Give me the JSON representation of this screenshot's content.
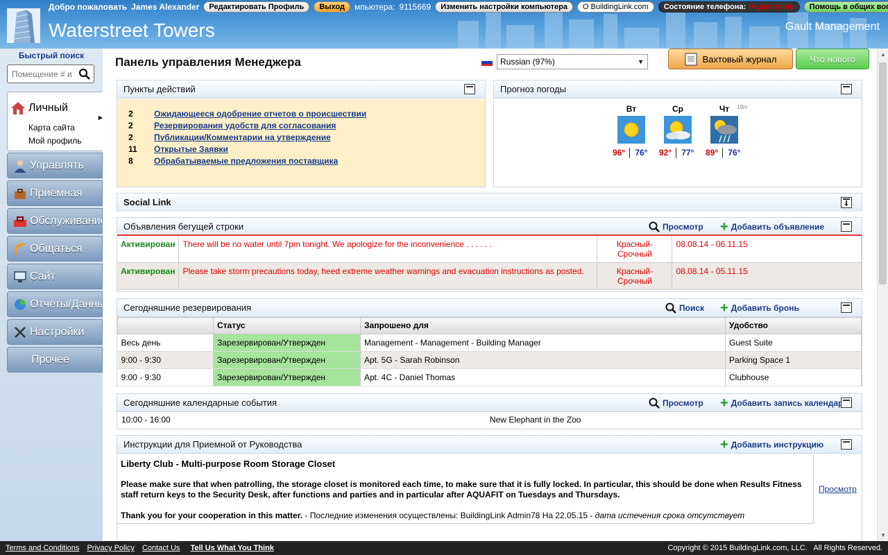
{
  "header": {
    "welcome": "Добро пожаловать",
    "user": "James Alexander",
    "edit_profile": "Редактировать Профиль",
    "logout": "Выход",
    "computer_label": "мпьютера:",
    "computer_id": "9115669",
    "change_settings": "Изменить настройки компьютера",
    "about": "О BuildingLink.com",
    "phone_state_label": "Состояние телефона:",
    "phone_state_value": "Недоступно",
    "help": "Помощь в общих вопросах",
    "app_title": "Waterstreet Towers",
    "management": "Gault Management"
  },
  "sidebar": {
    "quick_search_label": "Быстрый поиск",
    "search_placeholder": "Помещение # и",
    "personal": {
      "label": "Личный",
      "links": [
        "Карта сайта",
        "Мой профиль"
      ]
    },
    "items": [
      {
        "label": "Управлять",
        "icon": "person-icon"
      },
      {
        "label": "Приемная",
        "icon": "briefcase-icon"
      },
      {
        "label": "Обслуживание",
        "icon": "toolbox-icon"
      },
      {
        "label": "Общаться",
        "icon": "wifi-icon"
      },
      {
        "label": "Сайт",
        "icon": "monitor-icon"
      },
      {
        "label": "Отчеты/Данные",
        "icon": "pie-chart-icon"
      },
      {
        "label": "Настройки",
        "icon": "tools-icon"
      },
      {
        "label": "Прочее",
        "icon": ""
      }
    ]
  },
  "main": {
    "title": "Панель управления Менеджера",
    "language": "Russian (97%)",
    "log_button": "Вахтовый журнал",
    "whats_new": "Что нового",
    "actions": {
      "title": "Пункты действий",
      "items": [
        {
          "count": "2",
          "label": "Ожидающееся одобрение отчетов о происшествии"
        },
        {
          "count": "2",
          "label": "Резервирования удобств для согласования"
        },
        {
          "count": "2",
          "label": "Публикации/Комментарии на утверждение"
        },
        {
          "count": "11",
          "label": "Открытые Заявки"
        },
        {
          "count": "8",
          "label": "Обрабатываемые предложения поставщика"
        }
      ]
    },
    "weather": {
      "title": "Прогноз погоды",
      "updated": "19m",
      "days": [
        {
          "day": "Вт",
          "hi": "96°",
          "lo": "76°",
          "icon": "sun-icon"
        },
        {
          "day": "Ср",
          "hi": "92°",
          "lo": "77°",
          "icon": "partly-cloudy-icon"
        },
        {
          "day": "Чт",
          "hi": "89°",
          "lo": "76°",
          "icon": "storm-icon"
        }
      ]
    },
    "social_link": {
      "title": "Social Link"
    },
    "ticker": {
      "title": "Объявления бегущей строки",
      "view": "Просмотр",
      "add": "Добавить объявление",
      "rows": [
        {
          "status": "Активирован",
          "text": "There will be no water until 7pm tonight. We apologize for the inconvenience . . . . . .",
          "priority": "Красный-Срочный",
          "dates": "08.08.14 - 06.11.15"
        },
        {
          "status": "Активирован",
          "text": "Please take storm precautions today, heed extreme weather warnings and evacuation instructions as posted.",
          "priority": "Красный-Срочный",
          "dates": "08.08.14 - 05.11.15"
        }
      ]
    },
    "reservations": {
      "title": "Сегодняшние резервирования",
      "search": "Поиск",
      "add": "Добавить бронь",
      "headers": [
        "",
        "Статус",
        "Запрошено для",
        "Удобство"
      ],
      "rows": [
        {
          "time": "Весь день",
          "status": "Зарезервирован/Утвержден",
          "for": "Management - Management - Building Manager",
          "amenity": "Guest Suite"
        },
        {
          "time": "9:00 - 9:30",
          "status": "Зарезервирован/Утвержден",
          "for": "Apt. 5G - Sarah Robinson",
          "amenity": "Parking Space 1"
        },
        {
          "time": "9:00 - 9:30",
          "status": "Зарезервирован/Утвержден",
          "for": "Apt. 4C - Daniel Thomas",
          "amenity": "Clubhouse"
        }
      ]
    },
    "calendar": {
      "title": "Сегодняшние календарные события",
      "view": "Просмотр",
      "add": "Добавить запись календаря",
      "rows": [
        {
          "time": "10:00 - 16:00",
          "event": "New Elephant in the Zoo"
        }
      ]
    },
    "instructions": {
      "title": "Инструкции для Приемной от Руководства",
      "add": "Добавить инструкцию",
      "heading": "Liberty Club - Multi-purpose Room Storage Closet",
      "body": "Please make sure that when patrolling, the storage closet is monitored each time, to make sure that it is fully locked. In particular, this should be done when Results Fitness staff return keys to the Security Desk, after functions and parties and in particular after AQUAFIT on Tuesdays and Thursdays.",
      "thanks": "Thank you for your cooperation in this matter.",
      "changed": " - Последние изменения осуществлены: BuildingLink Admin78 На 22.05.15 - ",
      "expiry": "дата истечения срока отсутствует",
      "view": "Просмотр"
    }
  },
  "footer": {
    "links": [
      "Terms and Conditions",
      "Privacy Policy",
      "Contact Us"
    ],
    "feedback": "Tell Us What You Think",
    "copyright": "Copyright © 2015 BuildingLink.com, LLC.   All Rights Reserved."
  }
}
